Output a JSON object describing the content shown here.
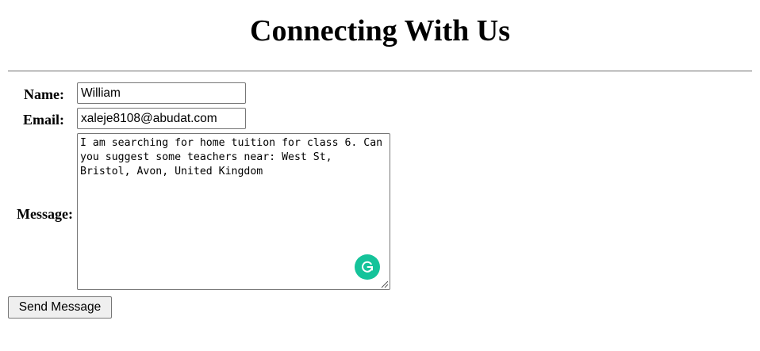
{
  "page": {
    "title": "Connecting With Us"
  },
  "form": {
    "name_label": "Name:",
    "name_value": "William",
    "email_label": "Email:",
    "email_value": "xaleje8108@abudat.com",
    "message_label": "Message:",
    "message_value": "I am searching for home tuition for class 6. Can you suggest some teachers near: West St, Bristol, Avon, United Kingdom",
    "submit_label": "Send Message"
  },
  "icons": {
    "grammarly": "grammarly-icon",
    "resize": "resize-handle-icon"
  },
  "colors": {
    "grammarly_green": "#15c39a",
    "button_bg": "#efefef",
    "input_border": "#767676"
  }
}
